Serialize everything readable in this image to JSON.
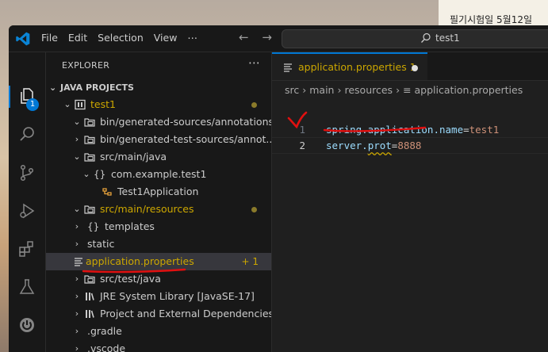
{
  "desktop": {
    "note_text": "필기시험일 5월12일"
  },
  "titlebar": {
    "menu": [
      "File",
      "Edit",
      "Selection",
      "View",
      "⋯"
    ],
    "search_text": "test1"
  },
  "activity": {
    "explorer_badge": "1"
  },
  "explorer": {
    "header": "EXPLORER",
    "more": "⋯",
    "section": "JAVA PROJECTS",
    "rows": [
      {
        "label": "test1",
        "changed": true
      },
      {
        "label": "bin/generated-sources/annotations"
      },
      {
        "label": "bin/generated-test-sources/annot..."
      },
      {
        "label": "src/main/java"
      },
      {
        "label": "com.example.test1"
      },
      {
        "label": "Test1Application"
      },
      {
        "label": "src/main/resources",
        "changed": true
      },
      {
        "label": "templates"
      },
      {
        "label": "static"
      },
      {
        "label": "application.properties",
        "count": "+ 1"
      },
      {
        "label": "src/test/java"
      },
      {
        "label": "JRE System Library [JavaSE-17]"
      },
      {
        "label": "Project and External Dependencies"
      },
      {
        "label": ".gradle"
      },
      {
        "label": ".vscode"
      }
    ]
  },
  "editor": {
    "tab_label": "application.properties 1",
    "breadcrumb": [
      "src",
      "main",
      "resources",
      "application.properties"
    ],
    "lines": [
      {
        "num": "1",
        "key": "spring.application.name",
        "eq": "=",
        "value": "test1"
      },
      {
        "num": "2",
        "key_a": "server.",
        "key_b": "prot",
        "eq": "=",
        "value": "8888"
      }
    ]
  },
  "colors": {
    "accent": "#0078d4",
    "modified": "#cca700",
    "annotation": "#e01010"
  }
}
